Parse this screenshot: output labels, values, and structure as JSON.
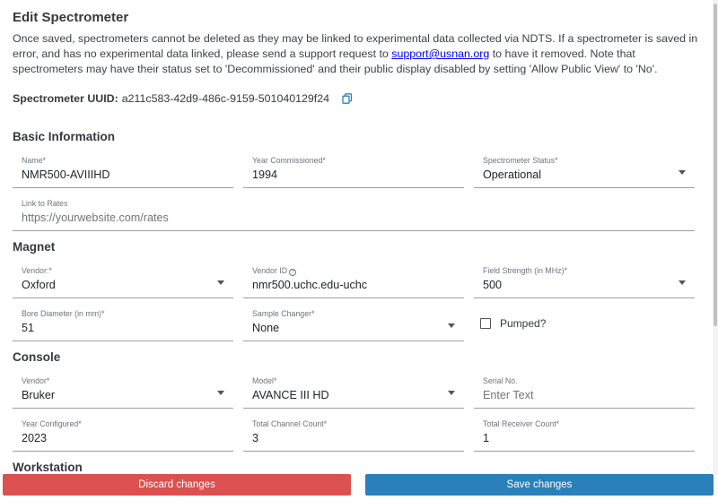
{
  "page": {
    "title": "Edit Spectrometer",
    "intro_part1": "Once saved, spectrometers cannot be deleted as they may be linked to experimental data collected via NDTS. If a spectrometer is saved in error, and has no experimental data linked, please send a support request to ",
    "support_email": "support@usnan.org",
    "intro_part2": " to have it removed. Note that spectrometers may have their status set to 'Decommissioned' and their public display disabled by setting 'Allow Public View' to 'No'.",
    "uuid_label": "Spectrometer UUID:",
    "uuid_value": "a211c583-42d9-486c-9159-501040129f24"
  },
  "basic": {
    "heading": "Basic Information",
    "name_label": "Name*",
    "name_value": "NMR500-AVIIIHD",
    "year_label": "Year Commissioned*",
    "year_value": "1994",
    "status_label": "Spectrometer Status*",
    "status_value": "Operational",
    "rates_label": "Link to Rates",
    "rates_placeholder": "https://yourwebsite.com/rates"
  },
  "magnet": {
    "heading": "Magnet",
    "vendor_label": "Vendor:*",
    "vendor_value": "Oxford",
    "vendor_id_label": "Vendor ID",
    "vendor_id_value": "nmr500.uchc.edu-uchc",
    "field_label": "Field Strength (in MHz)*",
    "field_value": "500",
    "bore_label": "Bore Diameter (in mm)*",
    "bore_value": "51",
    "sample_label": "Sample Changer*",
    "sample_value": "None",
    "pumped_label": "Pumped?"
  },
  "console": {
    "heading": "Console",
    "vendor_label": "Vendor*",
    "vendor_value": "Bruker",
    "model_label": "Model*",
    "model_value": "AVANCE III HD",
    "serial_label": "Serial No.",
    "serial_placeholder": "Enter Text",
    "year_label": "Year Configured*",
    "year_value": "2023",
    "channel_label": "Total Channel Count*",
    "channel_value": "3",
    "receiver_label": "Total Receiver Count*",
    "receiver_value": "1"
  },
  "workstation": {
    "heading": "Workstation"
  },
  "actions": {
    "discard_label": "Discard changes",
    "save_label": "Save changes"
  },
  "colors": {
    "discard": "#dc5050",
    "save": "#2a80b9",
    "link": "#0000ee"
  },
  "icons": {
    "copy": "copy-icon",
    "info": "info-circle-icon",
    "dropdown": "caret-down-icon"
  }
}
